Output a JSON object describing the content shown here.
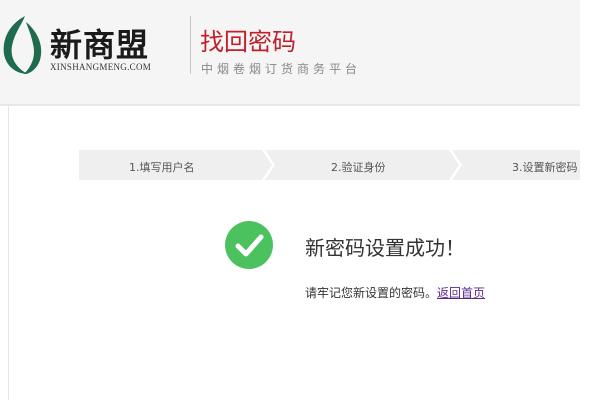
{
  "header": {
    "logo_name": "新商盟",
    "logo_domain": "XINSHANGMENG.COM",
    "page_title": "找回密码",
    "page_subtitle": "中烟卷烟订货商务平台"
  },
  "steps": [
    {
      "label": "1.填写用户名"
    },
    {
      "label": "2.验证身份"
    },
    {
      "label": "3.设置新密码"
    }
  ],
  "result": {
    "title": "新密码设置成功！",
    "note": "请牢记您新设置的密码。",
    "link": "返回首页"
  },
  "colors": {
    "brand_green": "#1e6b4e",
    "title_red": "#c0202a",
    "success_green": "#4cc25f",
    "step_bg": "#efefef",
    "link_purple": "#5a2a8c"
  }
}
